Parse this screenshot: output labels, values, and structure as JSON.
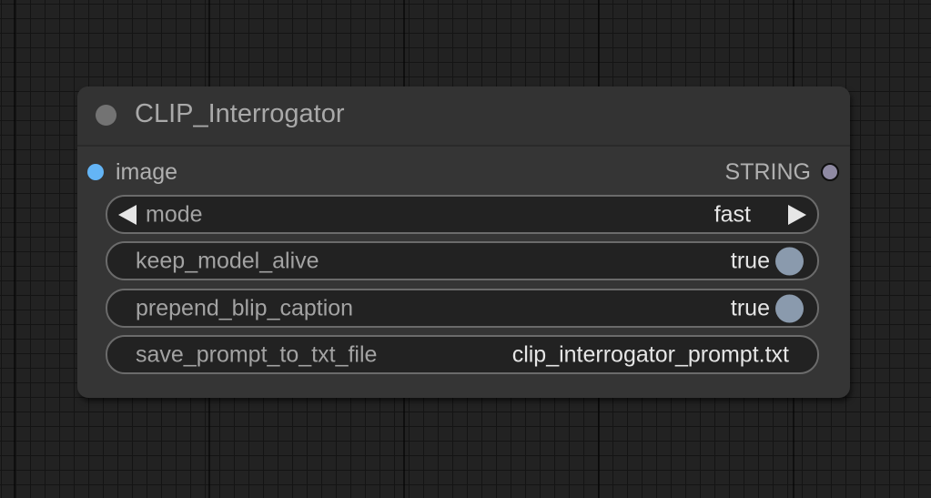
{
  "node": {
    "title": "CLIP_Interrogator",
    "input": {
      "label": "image",
      "color": "#64b5f6"
    },
    "output": {
      "label": "STRING"
    },
    "widgets": [
      {
        "type": "combo",
        "label": "mode",
        "value": "fast"
      },
      {
        "type": "toggle",
        "label": "keep_model_alive",
        "value": "true"
      },
      {
        "type": "toggle",
        "label": "prepend_blip_caption",
        "value": "true"
      },
      {
        "type": "text",
        "label": "save_prompt_to_txt_file",
        "value": "clip_interrogator_prompt.txt"
      }
    ]
  }
}
